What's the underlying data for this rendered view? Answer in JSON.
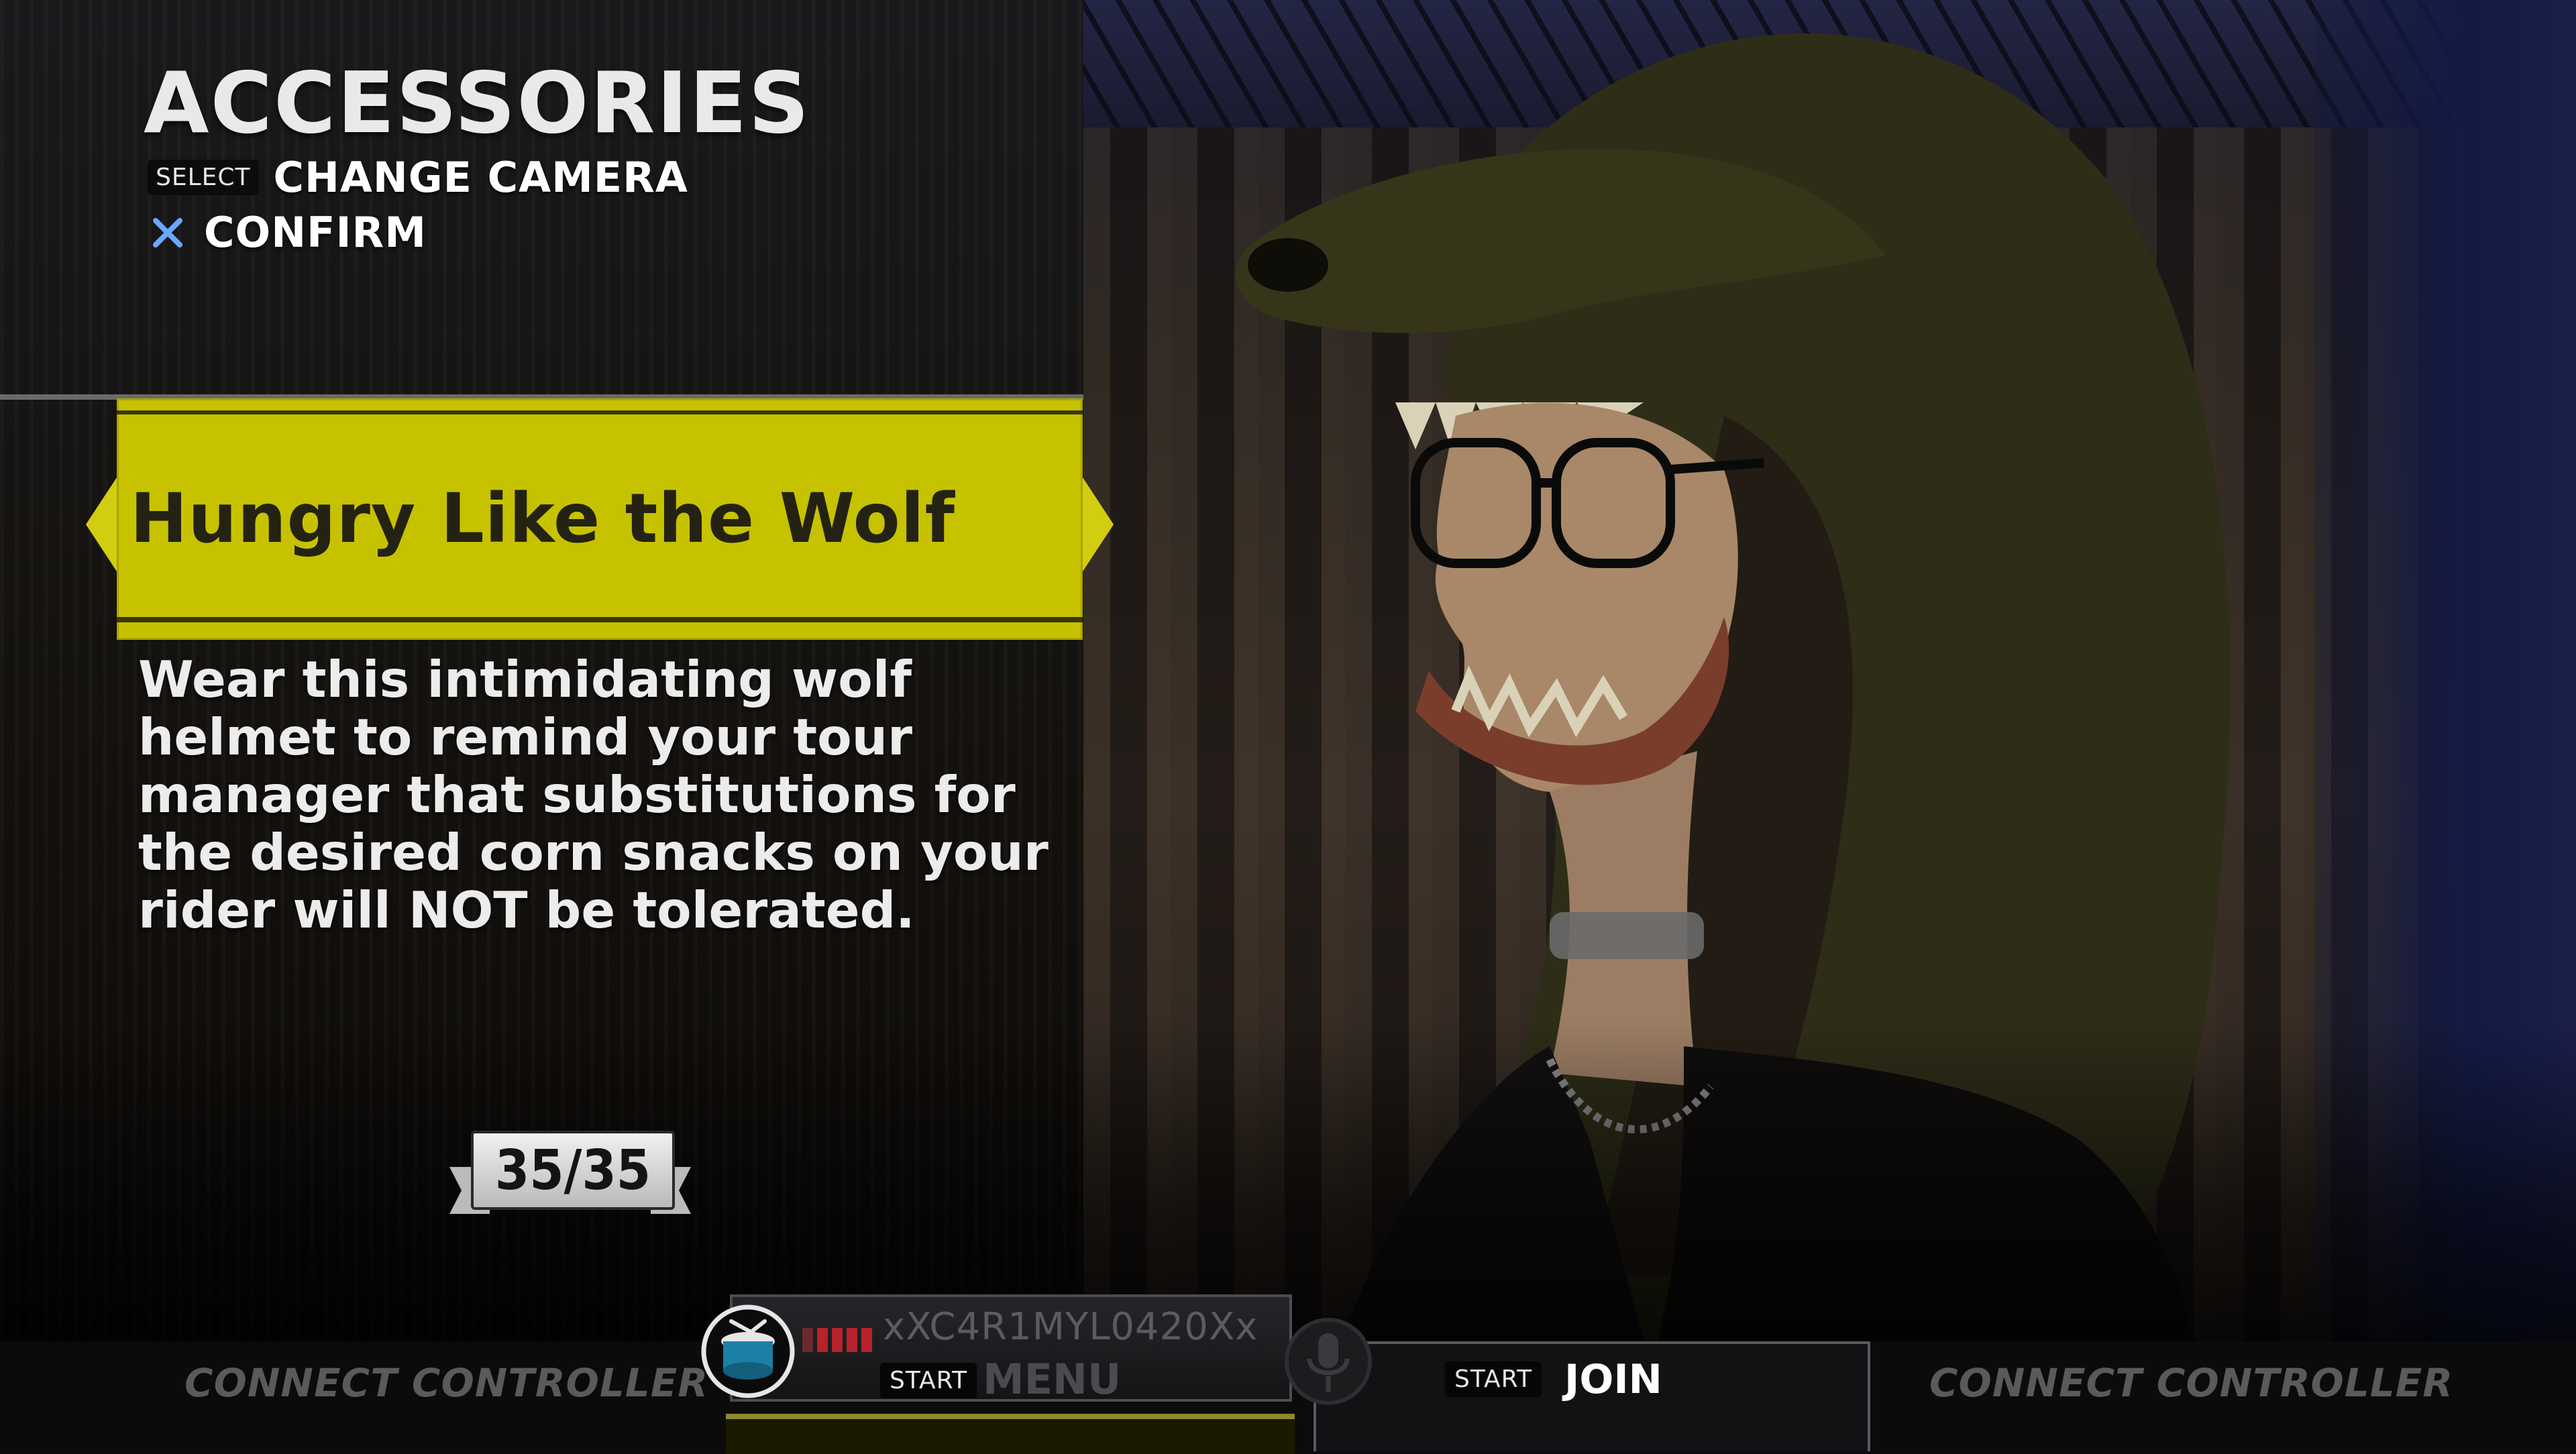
{
  "screen": {
    "title": "ACCESSORIES"
  },
  "controls": {
    "select_key": "SELECT",
    "select_action": "CHANGE CAMERA",
    "confirm_icon": "cross-button-icon",
    "confirm_action": "CONFIRM"
  },
  "item": {
    "name": "Hungry Like the Wolf",
    "description": "Wear this intimidating wolf helmet to remind your tour manager that substitutions for the desired corn snacks on your rider will NOT be tolerated.",
    "counter": "35/35"
  },
  "players": {
    "slot_1": {
      "status": "CONNECT CONTROLLER"
    },
    "slot_2": {
      "instrument_icon": "drum-icon",
      "gamertag": "xXC4R1MYL0420Xx",
      "start_key": "START",
      "action": "MENU"
    },
    "slot_3": {
      "instrument_icon": "microphone-icon",
      "start_key": "START",
      "action": "JOIN"
    },
    "slot_4": {
      "status": "CONNECT CONTROLLER"
    }
  },
  "colors": {
    "banner_yellow": "#c7c200",
    "confirm_blue": "#6aa8ff",
    "meter_red": "#b8222a"
  }
}
